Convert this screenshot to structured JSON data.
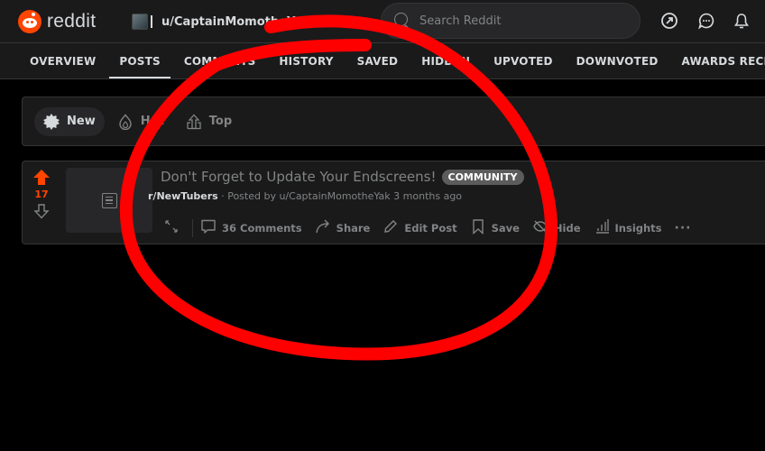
{
  "header": {
    "logo_text": "reddit",
    "user_name": "u/CaptainMomotheYak",
    "search_placeholder": "Search Reddit",
    "icons": [
      "popular-icon",
      "chat-icon",
      "notifications-icon"
    ]
  },
  "tabs": [
    {
      "label": "OVERVIEW",
      "active": false
    },
    {
      "label": "POSTS",
      "active": true
    },
    {
      "label": "COMMENTS",
      "active": false
    },
    {
      "label": "HISTORY",
      "active": false
    },
    {
      "label": "SAVED",
      "active": false
    },
    {
      "label": "HIDDEN",
      "active": false
    },
    {
      "label": "UPVOTED",
      "active": false
    },
    {
      "label": "DOWNVOTED",
      "active": false
    },
    {
      "label": "AWARDS RECEIVED",
      "active": false
    }
  ],
  "sort": [
    {
      "label": "New",
      "icon": "new-badge-icon",
      "active": true
    },
    {
      "label": "Hot",
      "icon": "flame-icon",
      "active": false
    },
    {
      "label": "Top",
      "icon": "top-icon",
      "active": false
    }
  ],
  "post": {
    "score": "17",
    "title": "Don't Forget to Update Your Endscreens!",
    "flair": "COMMUNITY",
    "subreddit": "r/NewTubers",
    "meta": "· Posted by u/CaptainMomotheYak 3 months ago",
    "actions": {
      "comments": "36 Comments",
      "share": "Share",
      "edit": "Edit Post",
      "save": "Save",
      "hide": "Hide",
      "insights": "Insights",
      "more": "···"
    }
  },
  "colors": {
    "brand": "#ff4500",
    "annotation": "#ff0000",
    "flair_bg": "#5c5c5c"
  }
}
